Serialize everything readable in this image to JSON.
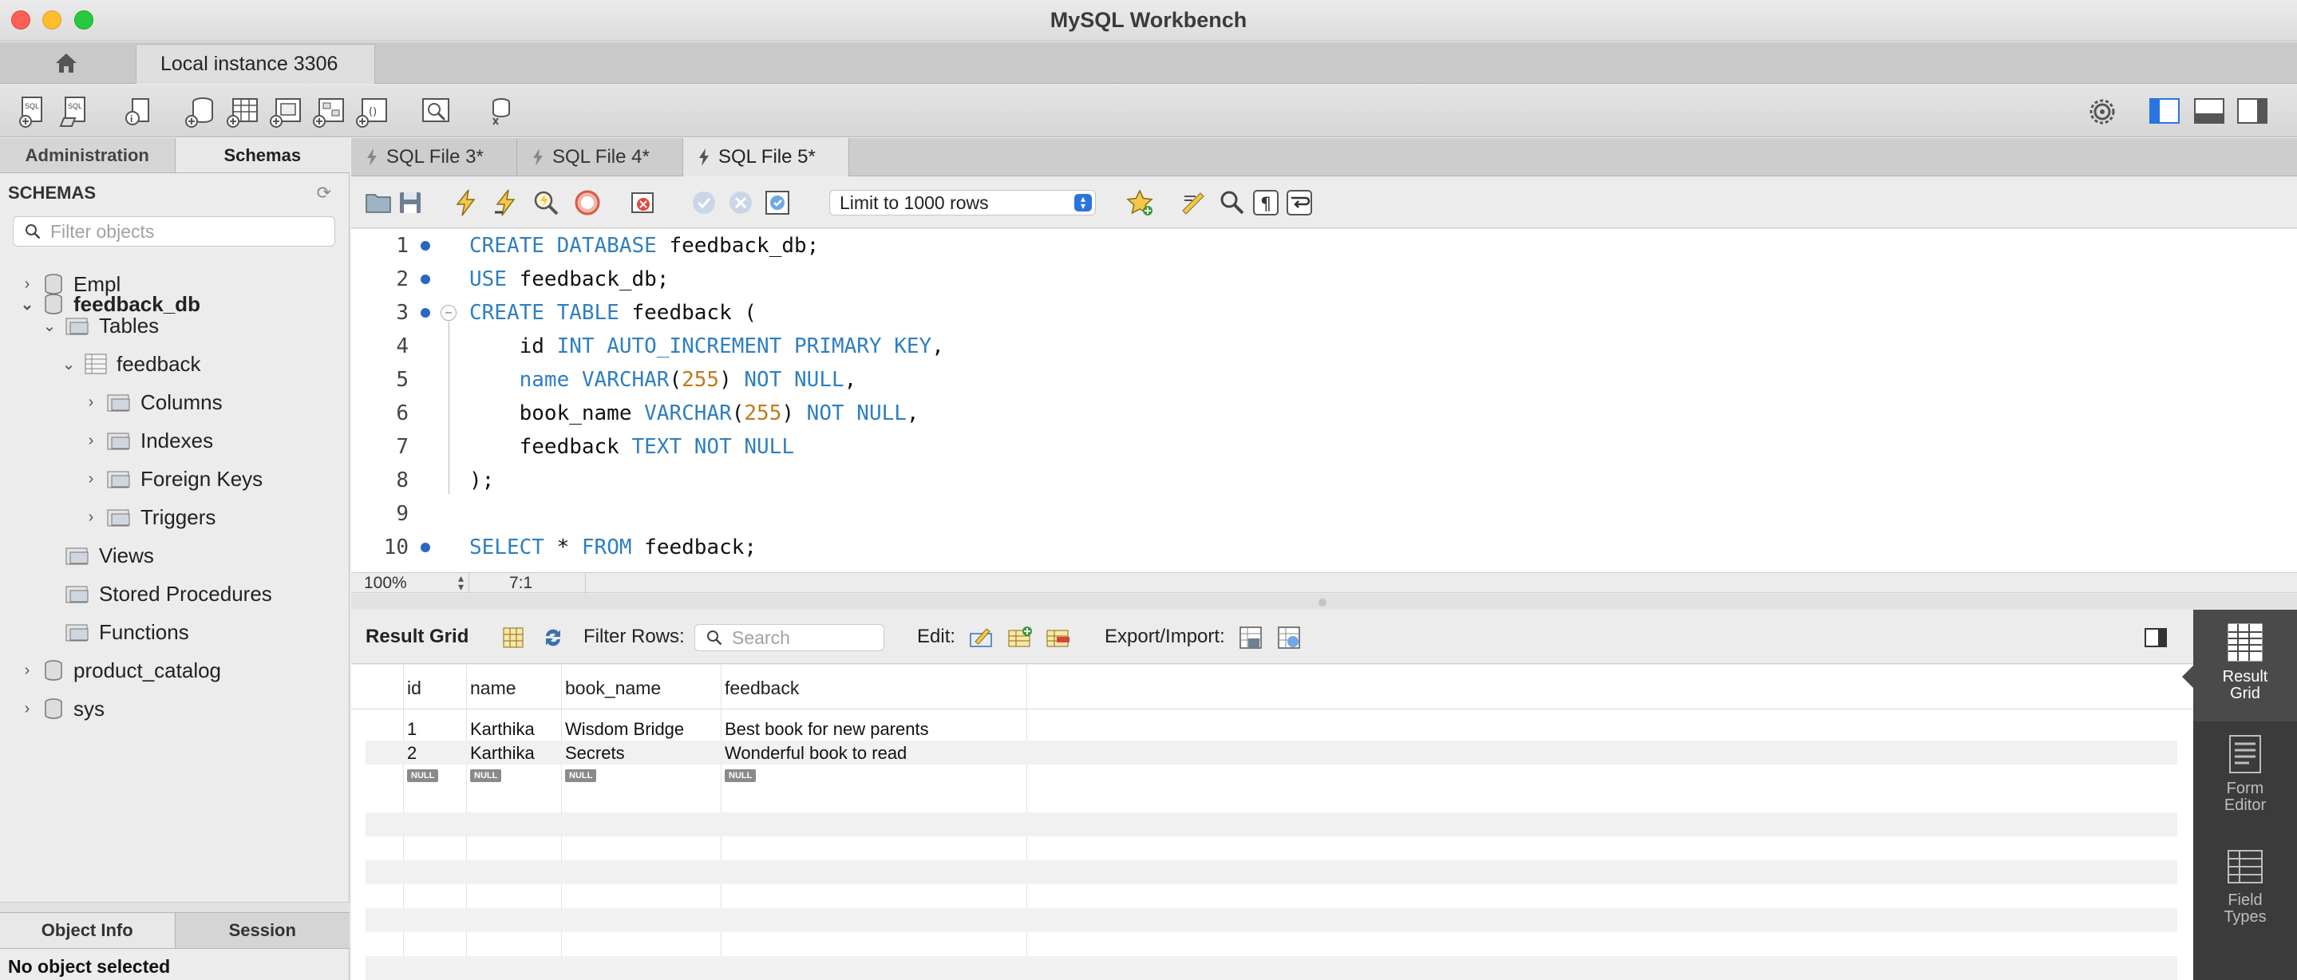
{
  "window": {
    "title": "MySQL Workbench"
  },
  "connection_tab": {
    "label": "Local instance 3306"
  },
  "sidebar": {
    "tabs": [
      "Administration",
      "Schemas"
    ],
    "header": "SCHEMAS",
    "filter_placeholder": "Filter objects",
    "tree": [
      {
        "label": "Empl"
      },
      {
        "label": "feedback_db"
      },
      {
        "label": "Tables"
      },
      {
        "label": "feedback"
      },
      {
        "label": "Columns"
      },
      {
        "label": "Indexes"
      },
      {
        "label": "Foreign Keys"
      },
      {
        "label": "Triggers"
      },
      {
        "label": "Views"
      },
      {
        "label": "Stored Procedures"
      },
      {
        "label": "Functions"
      },
      {
        "label": "product_catalog"
      },
      {
        "label": "sys"
      }
    ],
    "bottom_tabs": [
      "Object Info",
      "Session"
    ],
    "status": "No object selected"
  },
  "file_tabs": [
    "SQL File 3*",
    "SQL File 4*",
    "SQL File 5*"
  ],
  "editor_toolbar": {
    "limit_select": "Limit to 1000 rows"
  },
  "editor": {
    "lines": [
      {
        "n": "1",
        "parts": [
          [
            "kw",
            "CREATE DATABASE"
          ],
          [
            "t",
            " feedback_db;"
          ]
        ]
      },
      {
        "n": "2",
        "parts": [
          [
            "kw",
            "USE"
          ],
          [
            "t",
            " feedback_db;"
          ]
        ]
      },
      {
        "n": "3",
        "parts": [
          [
            "kw",
            "CREATE TABLE"
          ],
          [
            "t",
            " feedback ("
          ]
        ]
      },
      {
        "n": "4",
        "parts": [
          [
            "t",
            "    id "
          ],
          [
            "kw",
            "INT AUTO_INCREMENT PRIMARY KEY"
          ],
          [
            "t",
            ","
          ]
        ]
      },
      {
        "n": "5",
        "parts": [
          [
            "t",
            "    "
          ],
          [
            "kw",
            "name VARCHAR"
          ],
          [
            "t",
            "("
          ],
          [
            "num",
            "255"
          ],
          [
            "t",
            ") "
          ],
          [
            "kw",
            "NOT NULL"
          ],
          [
            "t",
            ","
          ]
        ]
      },
      {
        "n": "6",
        "parts": [
          [
            "t",
            "    book_name "
          ],
          [
            "kw",
            "VARCHAR"
          ],
          [
            "t",
            "("
          ],
          [
            "num",
            "255"
          ],
          [
            "t",
            ") "
          ],
          [
            "kw",
            "NOT NULL"
          ],
          [
            "t",
            ","
          ]
        ]
      },
      {
        "n": "7",
        "parts": [
          [
            "t",
            "    feedback "
          ],
          [
            "kw",
            "TEXT NOT NULL"
          ]
        ]
      },
      {
        "n": "8",
        "parts": [
          [
            "t",
            ");"
          ]
        ]
      },
      {
        "n": "9",
        "parts": []
      },
      {
        "n": "10",
        "parts": [
          [
            "kw",
            "SELECT"
          ],
          [
            "t",
            " * "
          ],
          [
            "kw",
            "FROM"
          ],
          [
            "t",
            " feedback;"
          ]
        ]
      }
    ]
  },
  "status_bar": {
    "zoom": "100%",
    "cursor": "7:1"
  },
  "result_toolbar": {
    "title": "Result Grid",
    "filter_label": "Filter Rows:",
    "search_placeholder": "Search",
    "edit_label": "Edit:",
    "export_label": "Export/Import:"
  },
  "result_grid": {
    "columns": [
      "id",
      "name",
      "book_name",
      "feedback"
    ],
    "rows": [
      [
        "1",
        "Karthika",
        "Wisdom Bridge",
        "Best book for new parents"
      ],
      [
        "2",
        "Karthika",
        "Secrets",
        "Wonderful book to read"
      ]
    ],
    "null_label": "NULL"
  },
  "right_tabs": [
    {
      "label_1": "Result",
      "label_2": "Grid"
    },
    {
      "label_1": "Form",
      "label_2": "Editor"
    },
    {
      "label_1": "Field",
      "label_2": "Types"
    }
  ],
  "colors": {
    "keyword": "#2f7fc0",
    "number": "#c07a1a",
    "accent": "#2b73e0"
  }
}
